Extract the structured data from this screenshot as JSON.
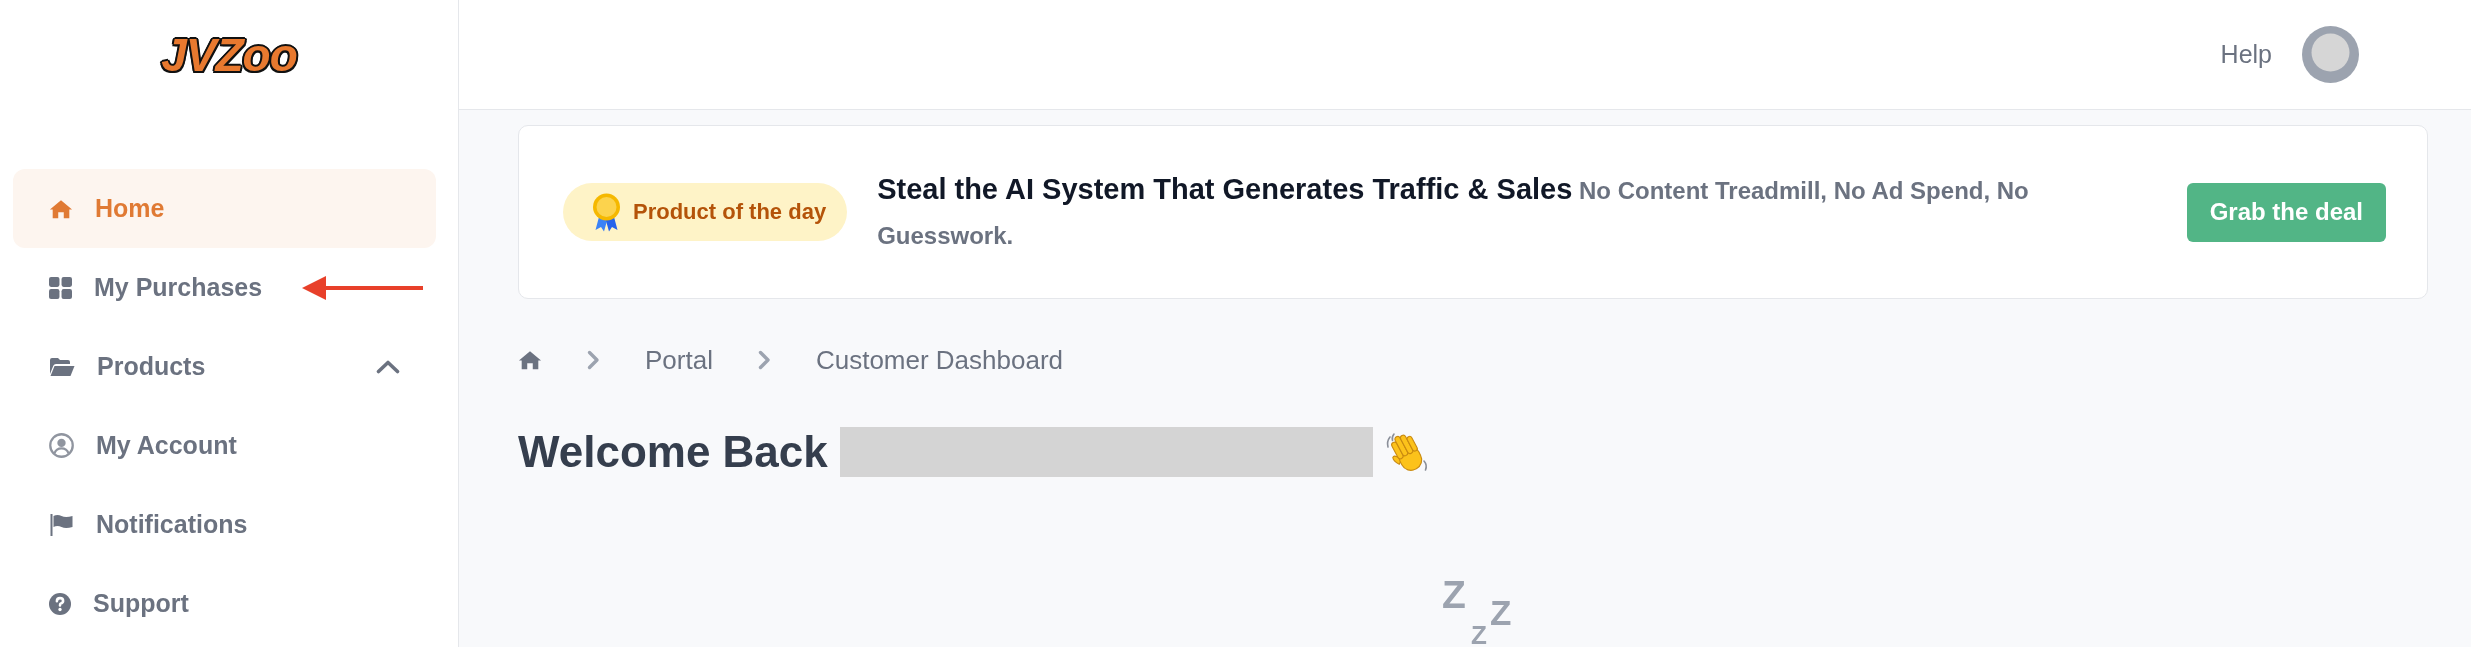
{
  "sidebar": {
    "logo": "JVZoo",
    "items": [
      {
        "label": "Home",
        "kind": "link",
        "selected": true,
        "annotated": false
      },
      {
        "label": "My Purchases",
        "kind": "link",
        "selected": false,
        "annotated": true
      },
      {
        "label": "Products",
        "kind": "group",
        "expanded": true,
        "selected": false,
        "annotated": false
      },
      {
        "label": "My Account",
        "kind": "link",
        "selected": false,
        "annotated": false
      },
      {
        "label": "Notifications",
        "kind": "link",
        "selected": false,
        "annotated": false
      },
      {
        "label": "Support",
        "kind": "link",
        "selected": false,
        "annotated": false
      }
    ]
  },
  "header": {
    "help": "Help"
  },
  "banner": {
    "badge": "Product of the day",
    "text": "**Steal the AI System That Generates Traffic & Sales** No Content Treadmill, No Ad Spend, No Guesswork.",
    "button": "Grab the deal"
  },
  "breadcrumb": [
    "Portal",
    "Customer Dashboard"
  ],
  "welcome": {
    "title": "Welcome Back",
    "name_redacted": true
  },
  "empty_state": {
    "marks": [
      "Z",
      "Z",
      "Z"
    ]
  }
}
